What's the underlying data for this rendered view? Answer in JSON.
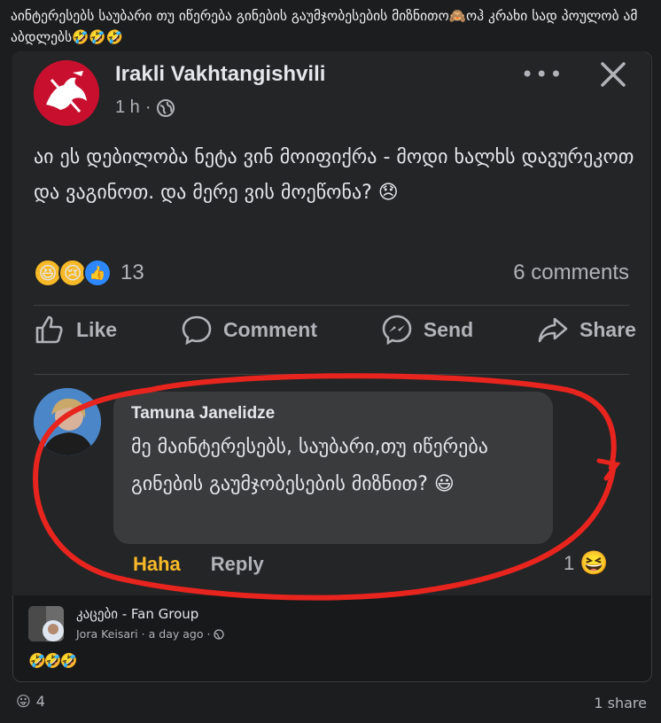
{
  "caption": "აინტერესებს საუბარი თუ იწერება გინების გაუმჯობესების მიზნითო🙈ოჰ კრახი სად პოულობ ამ აბდლებს🤣🤣🤣",
  "post": {
    "author": "Irakli Vakhtangishvili",
    "time": "1 h",
    "dot": "·",
    "more_icon": "•••",
    "text": "აი ეს დებილობა ნეტა ვინ მოიფიქრა - მოდი ხალხს დავურეკოთ და ვაგინოთ. და მერე ვის მოეწონა? 😞",
    "reactions": {
      "icons": [
        "haha",
        "sad",
        "like"
      ],
      "haha_glyph": "😆",
      "sad_glyph": "😢",
      "like_glyph": "👍",
      "count": "13"
    },
    "comments_count": "6 comments",
    "actions": {
      "like": "Like",
      "comment": "Comment",
      "send": "Send",
      "share": "Share"
    }
  },
  "comment": {
    "author": "Tamuna Janelidze",
    "text": "მე მაინტერესებს, საუბარი,თუ იწერება გინების გაუმჯობესების მიზნით? 😃",
    "reaction_label": "Haha",
    "reply_label": "Reply",
    "reaction_count": "1",
    "reaction_glyph": "😆"
  },
  "group": {
    "name": "კაცები - Fan Group",
    "poster": "Jora Keisari",
    "time": "a day ago",
    "dot": "·",
    "emojis": "🤣🤣🤣"
  },
  "footer": {
    "reaction_glyph": "😛",
    "reaction_count": "4",
    "shares": "1 share"
  },
  "colors": {
    "accent_red": "#e8241e",
    "fb_blue": "#2d88ff",
    "haha_yellow": "#f7b928"
  }
}
